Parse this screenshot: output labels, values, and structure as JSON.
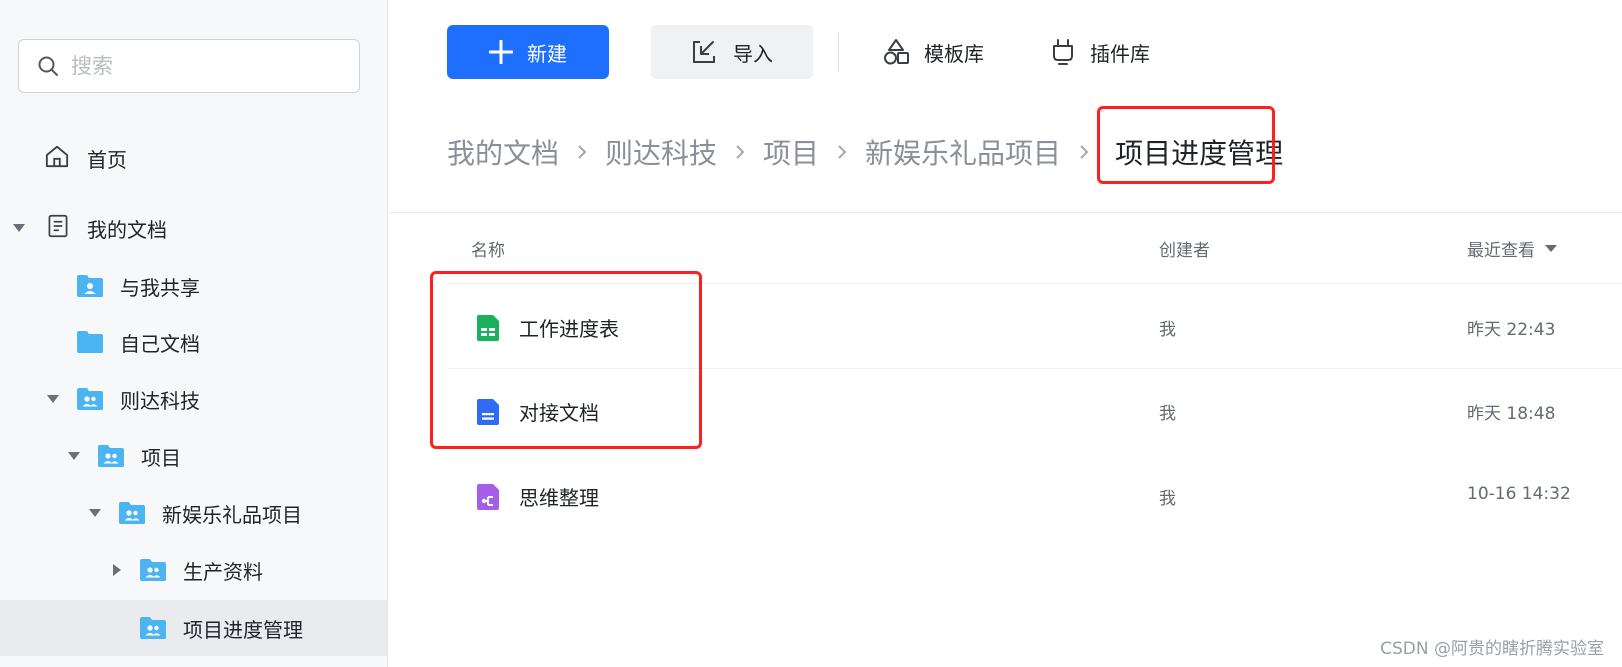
{
  "sidebar": {
    "search_placeholder": "搜索",
    "items": [
      {
        "label": "首页",
        "icon": "home-icon"
      },
      {
        "label": "我的文档",
        "icon": "document-icon",
        "expanded": true
      },
      {
        "label": "与我共享",
        "icon": "shared-folder-icon"
      },
      {
        "label": "自己文档",
        "icon": "folder-icon"
      },
      {
        "label": "则达科技",
        "icon": "team-folder-icon",
        "expanded": true
      },
      {
        "label": "项目",
        "icon": "team-folder-icon",
        "expanded": true
      },
      {
        "label": "新娱乐礼品项目",
        "icon": "team-folder-icon",
        "expanded": true
      },
      {
        "label": "生产资料",
        "icon": "team-folder-icon",
        "expanded": false
      },
      {
        "label": "项目进度管理",
        "icon": "team-folder-icon",
        "active": true
      }
    ]
  },
  "toolbar": {
    "new_label": "新建",
    "import_label": "导入",
    "template_label": "模板库",
    "plugin_label": "插件库"
  },
  "breadcrumb": [
    "我的文档",
    "则达科技",
    "项目",
    "新娱乐礼品项目",
    "项目进度管理"
  ],
  "table": {
    "headers": {
      "name": "名称",
      "creator": "创建者",
      "viewed": "最近查看"
    },
    "rows": [
      {
        "name": "工作进度表",
        "type": "sheet",
        "creator": "我",
        "viewed": "昨天 22:43"
      },
      {
        "name": "对接文档",
        "type": "doc",
        "creator": "我",
        "viewed": "昨天 18:48"
      },
      {
        "name": "思维整理",
        "type": "mindmap",
        "creator": "我",
        "viewed": "10-16 14:32"
      }
    ]
  },
  "colors": {
    "accent": "#1f6fff",
    "highlight": "#ff1f1f",
    "folder": "#4db4f2",
    "sheet": "#19b25a",
    "doc": "#2f6bf5",
    "mindmap": "#a45ee8"
  },
  "watermark": "CSDN @阿贵的瞎折腾实验室"
}
